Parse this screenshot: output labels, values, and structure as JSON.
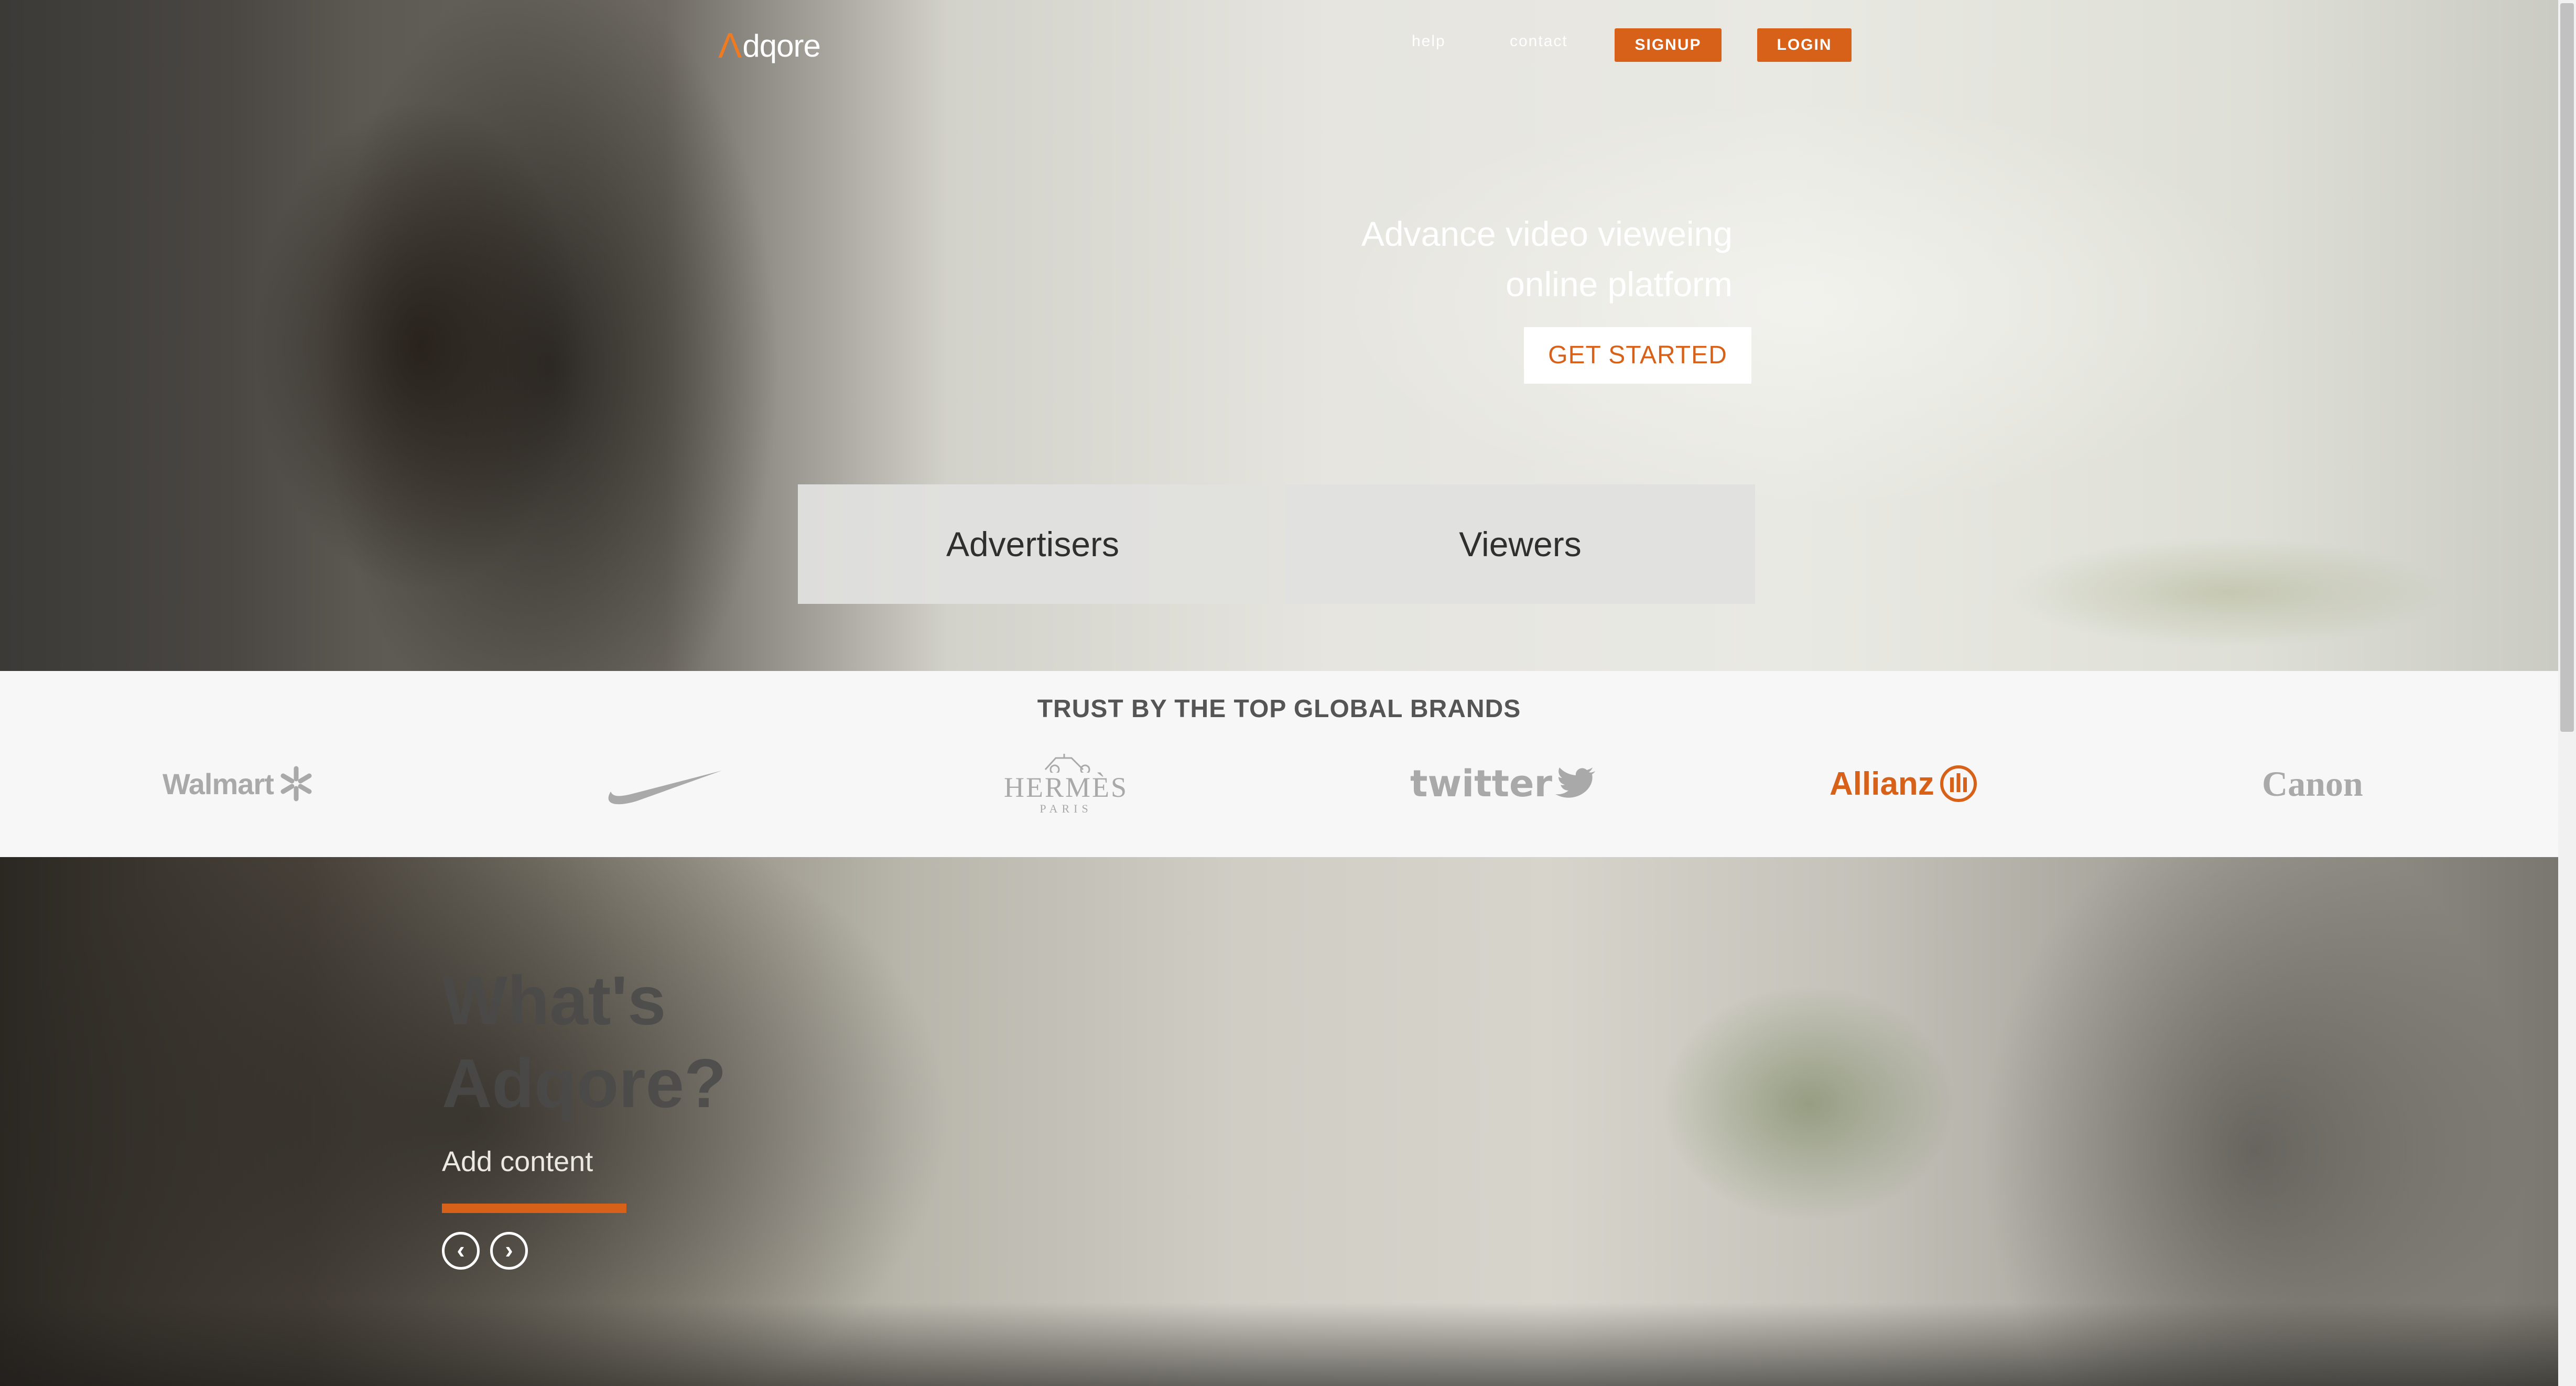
{
  "brand": {
    "logo_mark": "Λ",
    "logo_text": "dqore"
  },
  "nav": {
    "help": "help",
    "contact": "contact",
    "signup": "SIGNUP",
    "login": "LOGIN"
  },
  "hero": {
    "headline_line1": "Advance video vieweing",
    "headline_line2": "online platform",
    "cta": "GET STARTED",
    "tiles": {
      "advertisers": "Advertisers",
      "viewers": "Viewers"
    }
  },
  "brands_section": {
    "title": "TRUST BY THE TOP GLOBAL BRANDS",
    "logos": {
      "walmart": "Walmart",
      "nike_icon": "nike-swoosh-icon",
      "hermes": "HERMÈS",
      "hermes_sub": "PARIS",
      "twitter": "twitter",
      "allianz": "Allianz",
      "canon": "Canon"
    }
  },
  "about": {
    "title_line1": "What's",
    "title_line2": "Adqore?",
    "body": "Add content",
    "prev_icon": "chevron-left-icon",
    "next_icon": "chevron-right-icon"
  },
  "colors": {
    "accent": "#d8611a",
    "brands_bg": "#f7f7f7",
    "tile_bg": "#e0e0de"
  }
}
